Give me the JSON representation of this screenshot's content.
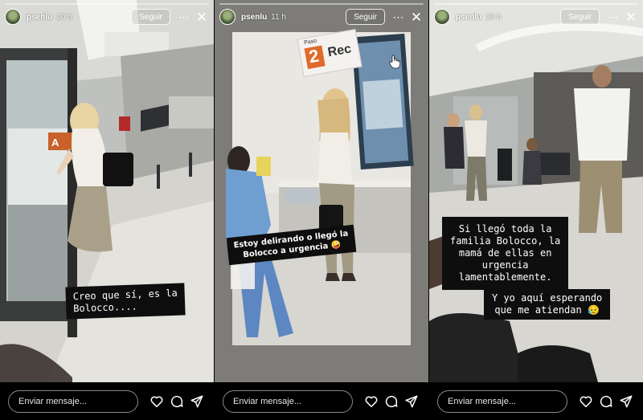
{
  "stories": [
    {
      "user": "psenlu",
      "time": "10 h",
      "follow_label": "Seguir",
      "more_glyph": "⋯",
      "close_glyph": "✕",
      "captions": [
        "Creo que sí, es la",
        "Bolocco...."
      ],
      "sign_letter": "A",
      "message_placeholder": "Enviar mensaje..."
    },
    {
      "user": "psenlu",
      "time": "11 h",
      "follow_label": "Seguir",
      "more_glyph": "⋯",
      "close_glyph": "✕",
      "captions": [
        "Estoy delirando o llegó la",
        "Bolocco a urgencia 🤪"
      ],
      "sign_small": "Paso",
      "sign_number": "2",
      "sign_text": "Rec",
      "message_placeholder": "Enviar mensaje..."
    },
    {
      "user": "psenlu",
      "time": "10 h",
      "follow_label": "Seguir",
      "more_glyph": "⋯",
      "close_glyph": "✕",
      "captions": [
        "Si llegó toda la",
        "familia Bolocco, la",
        "mamá de ellas en",
        "urgencia",
        "lamentablemente."
      ],
      "captions2": [
        "Y yo aquí esperando",
        "que me atiendan 😥"
      ],
      "message_placeholder": "Enviar mensaje..."
    }
  ],
  "icons": [
    "heart-icon",
    "comment-icon",
    "send-icon"
  ]
}
